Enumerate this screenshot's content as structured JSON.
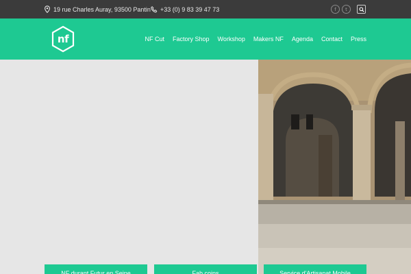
{
  "topbar": {
    "address": "19 rue Charles Auray, 93500 Pantin",
    "phone": "+33 (0) 9 83 39 47 73",
    "address_icon": "map-pin-icon",
    "phone_icon": "phone-icon",
    "social": [
      {
        "name": "facebook",
        "glyph": "f"
      },
      {
        "name": "twitter",
        "glyph": "t"
      }
    ]
  },
  "header": {
    "logo": "nf",
    "nav": [
      "NF Cut",
      "Factory Shop",
      "Workshop",
      "Makers NF",
      "Agenda",
      "Contact",
      "Press"
    ]
  },
  "buttons": [
    "NF durant Futur en Seine",
    "Fab coins",
    "Service d'Artisanat Mobile"
  ],
  "colors": {
    "accent": "#1ec992",
    "topbar": "#3b3b3b",
    "hero_bg": "#e6e6e6"
  }
}
